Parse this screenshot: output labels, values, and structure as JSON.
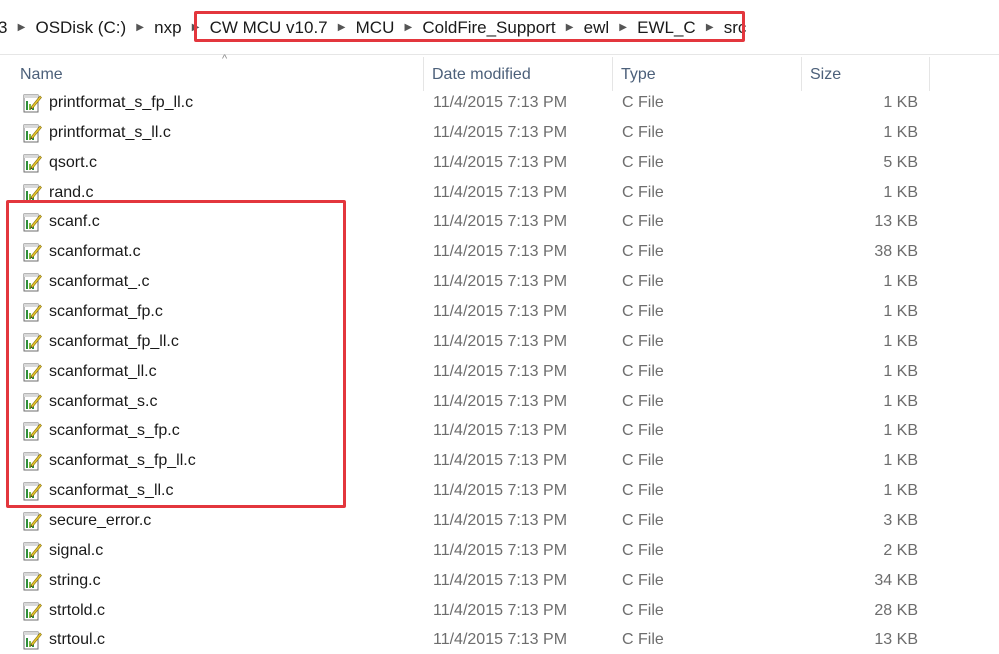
{
  "address_bar": {
    "crumbs_before": [
      "3",
      "OSDisk (C:)",
      "nxp"
    ],
    "crumbs_highlighted": [
      "CW MCU v10.7",
      "MCU",
      "ColdFire_Support",
      "ewl",
      "EWL_C",
      "src"
    ]
  },
  "columns": {
    "name": "Name",
    "date_modified": "Date modified",
    "type": "Type",
    "size": "Size"
  },
  "sort_indicator": "^",
  "highlight_color": "#e3363d",
  "icon": "c-source-file-icon",
  "files": [
    {
      "name": "printformat_s_fp_ll.c",
      "date": "11/4/2015 7:13 PM",
      "type": "C File",
      "size": "1 KB"
    },
    {
      "name": "printformat_s_ll.c",
      "date": "11/4/2015 7:13 PM",
      "type": "C File",
      "size": "1 KB"
    },
    {
      "name": "qsort.c",
      "date": "11/4/2015 7:13 PM",
      "type": "C File",
      "size": "5 KB"
    },
    {
      "name": "rand.c",
      "date": "11/4/2015 7:13 PM",
      "type": "C File",
      "size": "1 KB"
    },
    {
      "name": "scanf.c",
      "date": "11/4/2015 7:13 PM",
      "type": "C File",
      "size": "13 KB"
    },
    {
      "name": "scanformat.c",
      "date": "11/4/2015 7:13 PM",
      "type": "C File",
      "size": "38 KB"
    },
    {
      "name": "scanformat_.c",
      "date": "11/4/2015 7:13 PM",
      "type": "C File",
      "size": "1 KB"
    },
    {
      "name": "scanformat_fp.c",
      "date": "11/4/2015 7:13 PM",
      "type": "C File",
      "size": "1 KB"
    },
    {
      "name": "scanformat_fp_ll.c",
      "date": "11/4/2015 7:13 PM",
      "type": "C File",
      "size": "1 KB"
    },
    {
      "name": "scanformat_ll.c",
      "date": "11/4/2015 7:13 PM",
      "type": "C File",
      "size": "1 KB"
    },
    {
      "name": "scanformat_s.c",
      "date": "11/4/2015 7:13 PM",
      "type": "C File",
      "size": "1 KB"
    },
    {
      "name": "scanformat_s_fp.c",
      "date": "11/4/2015 7:13 PM",
      "type": "C File",
      "size": "1 KB"
    },
    {
      "name": "scanformat_s_fp_ll.c",
      "date": "11/4/2015 7:13 PM",
      "type": "C File",
      "size": "1 KB"
    },
    {
      "name": "scanformat_s_ll.c",
      "date": "11/4/2015 7:13 PM",
      "type": "C File",
      "size": "1 KB"
    },
    {
      "name": "secure_error.c",
      "date": "11/4/2015 7:13 PM",
      "type": "C File",
      "size": "3 KB"
    },
    {
      "name": "signal.c",
      "date": "11/4/2015 7:13 PM",
      "type": "C File",
      "size": "2 KB"
    },
    {
      "name": "string.c",
      "date": "11/4/2015 7:13 PM",
      "type": "C File",
      "size": "34 KB"
    },
    {
      "name": "strtold.c",
      "date": "11/4/2015 7:13 PM",
      "type": "C File",
      "size": "28 KB"
    },
    {
      "name": "strtoul.c",
      "date": "11/4/2015 7:13 PM",
      "type": "C File",
      "size": "13 KB"
    }
  ]
}
